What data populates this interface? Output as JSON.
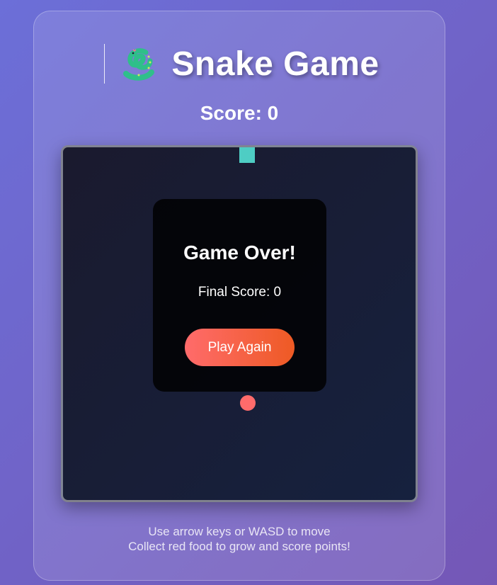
{
  "header": {
    "title": "Snake Game",
    "icon": "snake-icon"
  },
  "scoreboard": {
    "score_text": "Score: 0",
    "score": 0
  },
  "board": {
    "snake_color": "#4ecdc4",
    "food_color": "#ff6b6b"
  },
  "game_over": {
    "title": "Game Over!",
    "final_score_text": "Final Score: 0",
    "play_again_label": "Play Again"
  },
  "instructions": {
    "line1": "Use arrow keys or WASD to move",
    "line2": "Collect red food to grow and score points!"
  },
  "colors": {
    "accent_start": "#ff6b6b",
    "accent_end": "#ee5a24"
  }
}
